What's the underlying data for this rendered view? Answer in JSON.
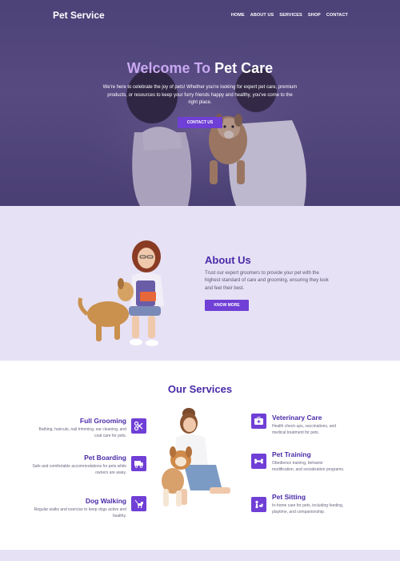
{
  "nav": {
    "brand": "Pet Service",
    "items": [
      "HOME",
      "ABOUT US",
      "SERVICES",
      "SHOP",
      "CONTACT"
    ]
  },
  "hero": {
    "title_part1": "Welcome To",
    "title_part2": "Pet Care",
    "subtitle": "We're here to celebrate the joy of pets! Whether you're looking for expert pet care, premium products, or resources to keep your furry friends happy and healthy, you've come to the right place.",
    "button": "CONTACT US"
  },
  "about": {
    "title": "About Us",
    "text": "Trust our expert groomers to provide your pet with the highest standard of care and grooming, ensuring they look and feel their best.",
    "button": "KNOW MORE"
  },
  "services": {
    "title": "Our Services",
    "left": [
      {
        "name": "Full Grooming",
        "desc": "Bathing, haircuts, nail trimming, ear cleaning, and coat care for pets.",
        "icon": "scissors-icon"
      },
      {
        "name": "Pet Boarding",
        "desc": "Safe and comfortable accommodations for pets while owners are away.",
        "icon": "van-icon"
      },
      {
        "name": "Dog Walking",
        "desc": "Regular walks and exercise to keep dogs active and healthy.",
        "icon": "dog-walk-icon"
      }
    ],
    "right": [
      {
        "name": "Veterinary Care",
        "desc": "Health check-ups, vaccinations, and medical treatment for pets.",
        "icon": "vet-kit-icon"
      },
      {
        "name": "Pet Training",
        "desc": "Obedience training, behavior modification, and socialization programs.",
        "icon": "bone-icon"
      },
      {
        "name": "Pet Sitting",
        "desc": "In-home care for pets, including feeding, playtime, and companionship.",
        "icon": "pet-sit-icon"
      }
    ]
  },
  "colors": {
    "accent": "#6f3fd6",
    "heading": "#4a2aa8",
    "hero_overlay": "#4e4478",
    "about_bg": "#e6e1f4"
  }
}
